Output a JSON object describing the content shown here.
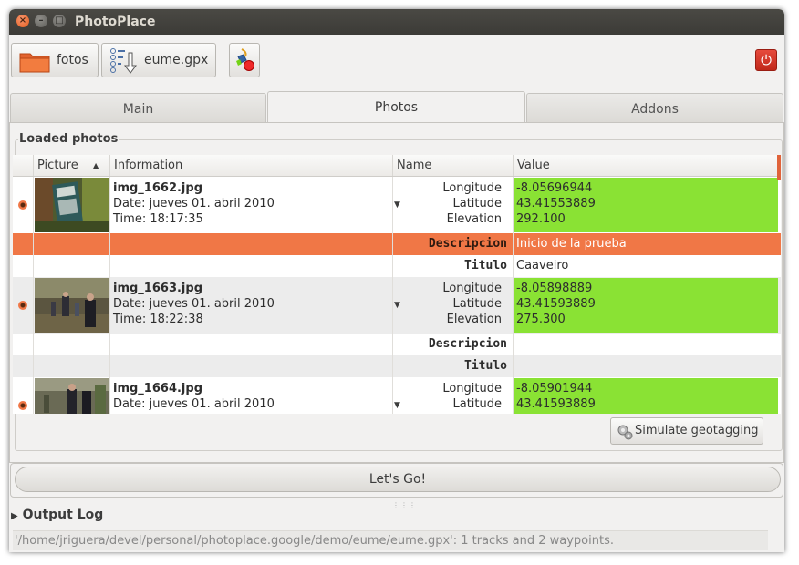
{
  "window": {
    "title": "PhotoPlace"
  },
  "toolbar": {
    "photos_button": "fotos",
    "gpx_button": "eume.gpx"
  },
  "tabs": [
    {
      "label": "Main",
      "active": false
    },
    {
      "label": "Photos",
      "active": true
    },
    {
      "label": "Addons",
      "active": false
    }
  ],
  "loaded_photos": {
    "title": "Loaded photos",
    "columns": [
      "Picture",
      "Information",
      "Name",
      "Value"
    ],
    "rows": [
      {
        "name": "img_1662.jpg",
        "date": "Date: jueves 01. abril 2010",
        "time": "Time: 18:17:35",
        "attributes": [
          {
            "name": "Longitude",
            "value": "-8.05696944"
          },
          {
            "name": "Latitude",
            "value": "43.41553889"
          },
          {
            "name": "Elevation",
            "value": "292.100"
          }
        ],
        "extra": [
          {
            "name": "Descripcion",
            "value": "Inicio de la prueba"
          },
          {
            "name": "Titulo",
            "value": "Caaveiro"
          }
        ]
      },
      {
        "name": "img_1663.jpg",
        "date": "Date: jueves 01. abril 2010",
        "time": "Time: 18:22:38",
        "attributes": [
          {
            "name": "Longitude",
            "value": "-8.05898889"
          },
          {
            "name": "Latitude",
            "value": "43.41593889"
          },
          {
            "name": "Elevation",
            "value": "275.300"
          }
        ],
        "extra": [
          {
            "name": "Descripcion",
            "value": ""
          },
          {
            "name": "Titulo",
            "value": ""
          }
        ]
      },
      {
        "name": "img_1664.jpg",
        "date": "Date: jueves 01. abril 2010",
        "attributes": [
          {
            "name": "Longitude",
            "value": "-8.05901944"
          },
          {
            "name": "Latitude",
            "value": "43.41593889"
          }
        ]
      }
    ]
  },
  "simulate_button": "Simulate geotagging",
  "go_button": "Let's Go!",
  "output_log": {
    "label": "Output Log"
  },
  "status": "'/home/jriguera/devel/personal/photoplace.google/demo/eume/eume.gpx': 1 tracks and 2 waypoints.",
  "colors": {
    "selection": "#f07746",
    "value_highlight": "#8ae234",
    "close_button": "#e35b1b",
    "power_button": "#d0321f"
  },
  "icons": [
    "folder-icon",
    "gpx-file-icon",
    "geotag-tool-icon",
    "power-icon",
    "sort-ascending-icon",
    "expander-icon",
    "gears-icon"
  ]
}
